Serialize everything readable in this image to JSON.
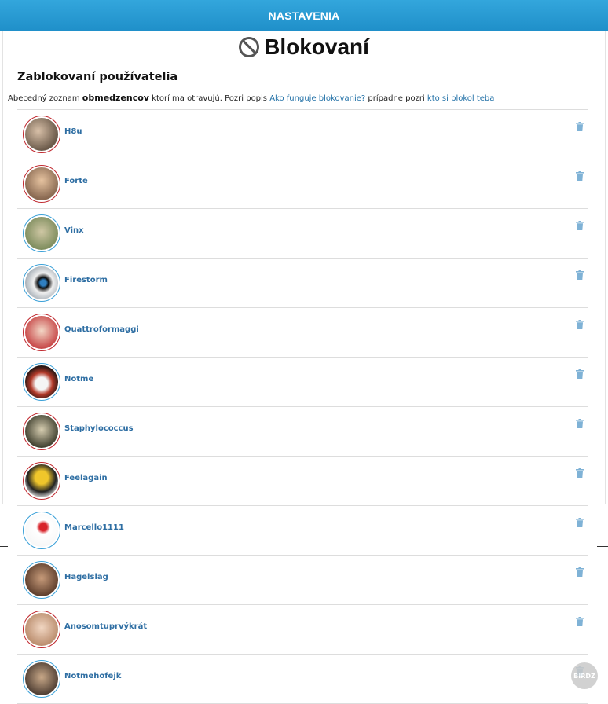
{
  "header": {
    "title": "NASTAVENIA"
  },
  "page": {
    "title": "Blokovaní",
    "title_icon": "block-icon"
  },
  "section": {
    "heading": "Zablokovaní používatelia",
    "desc_part1": "Abecedný zoznam",
    "desc_bold": "obmedzencov",
    "desc_part2": "ktorí ma otravujú. Pozri popis",
    "link_how": "Ako funguje blokovanie?",
    "desc_part3": "prípadne pozri",
    "link_who": "kto si blokol teba"
  },
  "colors": {
    "accent": "#2196d3",
    "username": "#2e6ea3",
    "ring_red": "#c0272d",
    "ring_blue": "#3aa0d8",
    "trash": "#7fb2d6"
  },
  "blocked_users": [
    {
      "name": "H8u",
      "ring": "red"
    },
    {
      "name": "Forte",
      "ring": "red"
    },
    {
      "name": "Vinx",
      "ring": "blue"
    },
    {
      "name": "Firestorm",
      "ring": "blue"
    },
    {
      "name": "Quattroformaggi",
      "ring": "red"
    },
    {
      "name": "Notme",
      "ring": "blue"
    },
    {
      "name": "Staphylococcus",
      "ring": "red"
    },
    {
      "name": "Feelagain",
      "ring": "red"
    },
    {
      "name": "Marcello1111",
      "ring": "blue"
    },
    {
      "name": "Hagelslag",
      "ring": "blue"
    },
    {
      "name": "Anosomtuprvýkrát",
      "ring": "red"
    },
    {
      "name": "Notmehofejk",
      "ring": "blue"
    }
  ],
  "watermark": {
    "text": "BIRDZ"
  }
}
